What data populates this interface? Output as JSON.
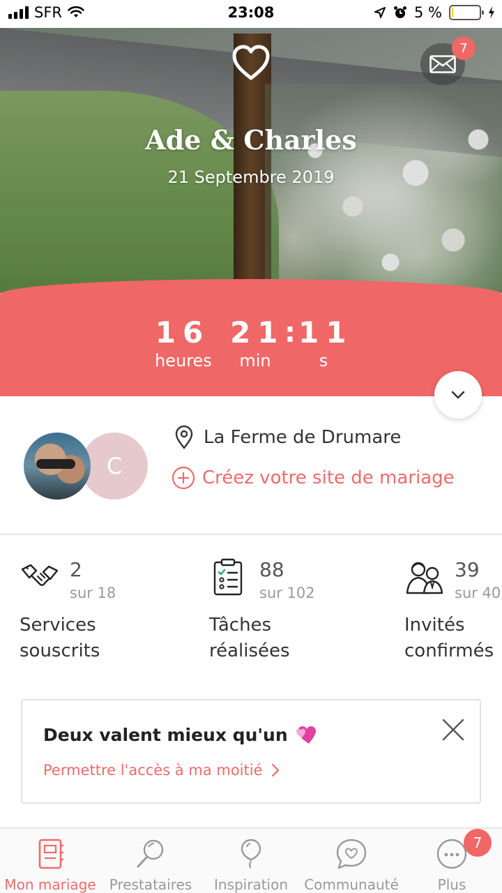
{
  "status_bar": {
    "carrier": "SFR",
    "time": "23:08",
    "battery_percent": "5 %",
    "battery_level": 0.05
  },
  "hero": {
    "couple_names": "Ade & Charles",
    "wedding_date": "21 Septembre 2019",
    "mail_badge_count": "7",
    "logo_icon": "heart-icon"
  },
  "countdown": {
    "hours": "16",
    "hours_label": "heures",
    "minutes": "21",
    "minutes_label": "min",
    "seconds": "11",
    "seconds_label": "s"
  },
  "couple": {
    "partner_initial": "C",
    "venue": "La Ferme de Drumare",
    "create_site_label": "Créez votre site de mariage"
  },
  "stats": [
    {
      "icon": "handshake-icon",
      "count": "2",
      "total": "sur 18",
      "label": "Services souscrits"
    },
    {
      "icon": "checklist-icon",
      "count": "88",
      "total": "sur 102",
      "label": "Tâches réalisées"
    },
    {
      "icon": "guests-icon",
      "count": "39",
      "total": "sur 40",
      "label": "Invités confirmés"
    }
  ],
  "promo": {
    "title": "Deux valent mieux qu'un",
    "link_label": "Permettre l'accès à ma moitié"
  },
  "bottom_nav": {
    "items": [
      {
        "label": "Mon mariage",
        "icon": "planner-icon"
      },
      {
        "label": "Prestataires",
        "icon": "search-icon"
      },
      {
        "label": "Inspiration",
        "icon": "balloon-icon"
      },
      {
        "label": "Communauté",
        "icon": "chat-heart-icon"
      },
      {
        "label": "Plus",
        "icon": "more-icon"
      }
    ],
    "more_badge_count": "7"
  },
  "colors": {
    "accent": "#f06767",
    "link": "#ee6b6b",
    "partner_avatar": "#e6c9cc"
  }
}
